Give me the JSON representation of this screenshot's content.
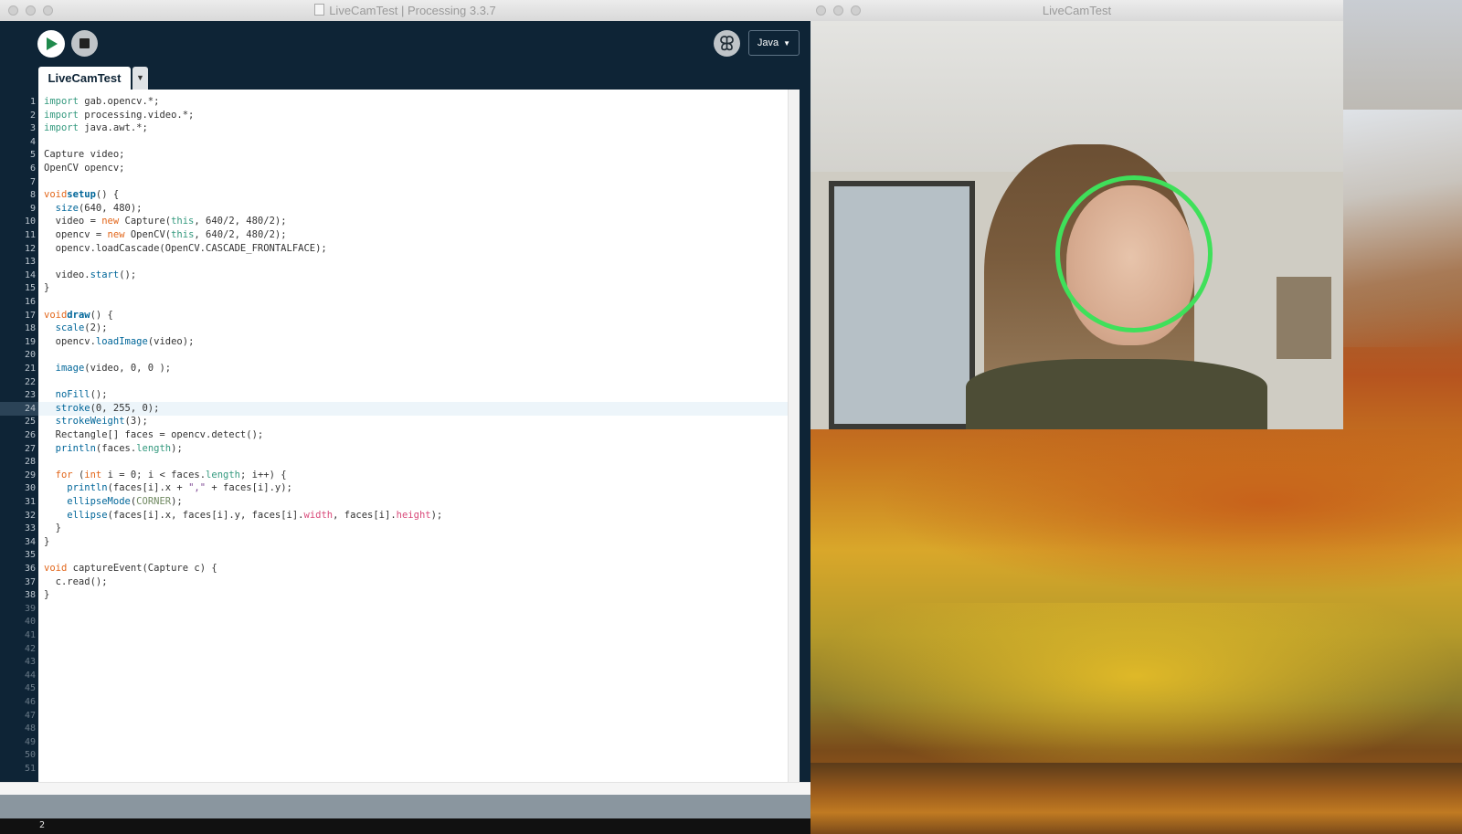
{
  "desktop": {
    "wallpaper": "macOS High Sierra autumn mountains and lake"
  },
  "editor_window": {
    "title": "LiveCamTest | Processing 3.3.7",
    "toolbar": {
      "run_icon": "play-icon",
      "stop_icon": "stop-icon",
      "debug_icon": "debugger-butterfly-icon",
      "mode": "Java"
    },
    "tabs": [
      {
        "label": "LiveCamTest"
      }
    ],
    "current_line": 24,
    "code_lines": [
      [
        [
          "k-imp",
          "import"
        ],
        [
          "",
          "gab.opencv.*;"
        ]
      ],
      [
        [
          "k-imp",
          "import"
        ],
        [
          "",
          "processing.video.*;"
        ]
      ],
      [
        [
          "k-imp",
          "import"
        ],
        [
          "",
          "java.awt.*;"
        ]
      ],
      [],
      [
        [
          "",
          "Capture video;"
        ]
      ],
      [
        [
          "",
          "OpenCV opencv;"
        ]
      ],
      [],
      [
        [
          "k-type",
          "void"
        ],
        [
          "",
          ""
        ],
        [
          "k-fn",
          "setup"
        ],
        [
          "",
          "() {"
        ]
      ],
      [
        [
          "",
          "  "
        ],
        [
          "k-call",
          "size"
        ],
        [
          "",
          "(640, 480);"
        ]
      ],
      [
        [
          "",
          "  video = "
        ],
        [
          "k-type",
          "new"
        ],
        [
          "",
          "Capture("
        ],
        [
          "k-lit",
          "this"
        ],
        [
          "",
          ", 640/2, 480/2);"
        ]
      ],
      [
        [
          "",
          "  opencv = "
        ],
        [
          "k-type",
          "new"
        ],
        [
          "",
          "OpenCV("
        ],
        [
          "k-lit",
          "this"
        ],
        [
          "",
          ", 640/2, 480/2);"
        ]
      ],
      [
        [
          "",
          "  opencv.loadCascade(OpenCV.CASCADE_FRONTALFACE);"
        ]
      ],
      [],
      [
        [
          "",
          "  video."
        ],
        [
          "k-call",
          "start"
        ],
        [
          "",
          "();"
        ]
      ],
      [
        [
          "",
          "}"
        ]
      ],
      [],
      [
        [
          "k-type",
          "void"
        ],
        [
          "",
          ""
        ],
        [
          "k-fn",
          "draw"
        ],
        [
          "",
          "() {"
        ]
      ],
      [
        [
          "",
          "  "
        ],
        [
          "k-call",
          "scale"
        ],
        [
          "",
          "(2);"
        ]
      ],
      [
        [
          "",
          "  opencv."
        ],
        [
          "k-call",
          "loadImage"
        ],
        [
          "",
          "(video);"
        ]
      ],
      [],
      [
        [
          "",
          "  "
        ],
        [
          "k-call",
          "image"
        ],
        [
          "",
          "(video, 0, 0 );"
        ]
      ],
      [],
      [
        [
          "",
          "  "
        ],
        [
          "k-call",
          "noFill"
        ],
        [
          "",
          "();"
        ]
      ],
      [
        [
          "",
          "  "
        ],
        [
          "k-call",
          "stroke"
        ],
        [
          "",
          "(0, 255, 0);"
        ]
      ],
      [
        [
          "",
          "  "
        ],
        [
          "k-call",
          "strokeWeight"
        ],
        [
          "",
          "(3);"
        ]
      ],
      [
        [
          "",
          "  Rectangle[] faces = opencv.detect();"
        ]
      ],
      [
        [
          "",
          "  "
        ],
        [
          "k-call",
          "println"
        ],
        [
          "",
          "(faces."
        ],
        [
          "k-lit",
          "length"
        ],
        [
          "",
          ");"
        ]
      ],
      [],
      [
        [
          "",
          "  "
        ],
        [
          "k-type",
          "for"
        ],
        [
          "",
          " ("
        ],
        [
          "k-type",
          "int"
        ],
        [
          "",
          " i = 0; i < faces."
        ],
        [
          "k-lit",
          "length"
        ],
        [
          "",
          "; i++) {"
        ]
      ],
      [
        [
          "",
          "    "
        ],
        [
          "k-call",
          "println"
        ],
        [
          "",
          "(faces[i].x + "
        ],
        [
          "k-str",
          "\",\""
        ],
        [
          "",
          " + faces[i].y);"
        ]
      ],
      [
        [
          "",
          "    "
        ],
        [
          "k-call",
          "ellipseMode"
        ],
        [
          "",
          "("
        ],
        [
          "k-const",
          "CORNER"
        ],
        [
          "",
          ");"
        ]
      ],
      [
        [
          "",
          "    "
        ],
        [
          "k-call",
          "ellipse"
        ],
        [
          "",
          "(faces[i].x, faces[i].y, faces[i]."
        ],
        [
          "k-prop",
          "width"
        ],
        [
          "",
          ", faces[i]."
        ],
        [
          "k-prop",
          "height"
        ],
        [
          "",
          ");"
        ]
      ],
      [
        [
          "",
          "  }"
        ]
      ],
      [
        [
          "",
          "}"
        ]
      ],
      [],
      [
        [
          "k-type",
          "void"
        ],
        [
          "",
          " captureEvent(Capture c) {"
        ]
      ],
      [
        [
          "",
          "  c.read();"
        ]
      ],
      [
        [
          "",
          "}"
        ]
      ]
    ],
    "empty_line_numbers": [
      39,
      40,
      41,
      42,
      43,
      44,
      45,
      46,
      47,
      48,
      49,
      50,
      51
    ],
    "console": {
      "output": "2"
    }
  },
  "sketch_window": {
    "title": "LiveCamTest",
    "face_ring_color": "#3fe05a"
  }
}
